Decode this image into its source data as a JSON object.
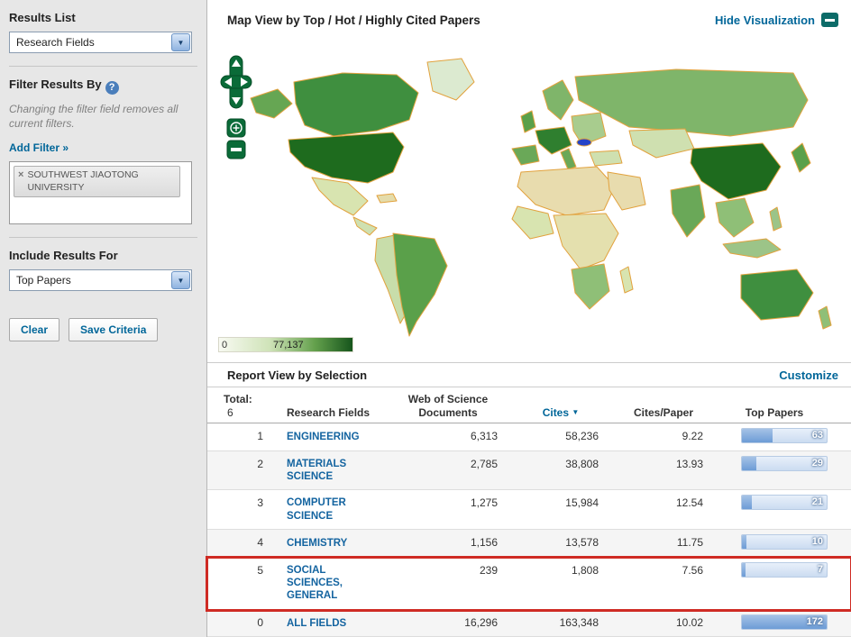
{
  "icons": {
    "chevron_down": "▼",
    "sort_desc": "▼",
    "help": "?",
    "remove": "×"
  },
  "sidebar": {
    "results_list": {
      "label": "Results List",
      "value": "Research Fields"
    },
    "filter": {
      "label": "Filter Results By",
      "note": "Changing the filter field removes all current filters.",
      "add_filter": "Add Filter »",
      "tag": "SOUTHWEST JIAOTONG UNIVERSITY"
    },
    "include": {
      "label": "Include Results For",
      "value": "Top Papers"
    },
    "buttons": {
      "clear": "Clear",
      "save": "Save Criteria"
    }
  },
  "map": {
    "title": "Map View by Top / Hot / Highly Cited Papers",
    "hide_link": "Hide Visualization",
    "legend": {
      "min": "0",
      "max": "77,137"
    }
  },
  "report": {
    "title": "Report View by Selection",
    "customize": "Customize",
    "total_label": "Total:",
    "total_value": "6",
    "columns": {
      "research_fields": "Research Fields",
      "documents": "Web of Science Documents",
      "cites": "Cites",
      "cites_per_paper": "Cites/Paper",
      "top_papers": "Top Papers"
    },
    "top_papers_max": 172,
    "rows": [
      {
        "rank": "1",
        "field": "ENGINEERING",
        "documents": "6,313",
        "cites": "58,236",
        "cites_per_paper": "9.22",
        "top_papers": "63",
        "top_papers_value": 63
      },
      {
        "rank": "2",
        "field": "MATERIALS SCIENCE",
        "documents": "2,785",
        "cites": "38,808",
        "cites_per_paper": "13.93",
        "top_papers": "29",
        "top_papers_value": 29
      },
      {
        "rank": "3",
        "field": "COMPUTER SCIENCE",
        "documents": "1,275",
        "cites": "15,984",
        "cites_per_paper": "12.54",
        "top_papers": "21",
        "top_papers_value": 21
      },
      {
        "rank": "4",
        "field": "CHEMISTRY",
        "documents": "1,156",
        "cites": "13,578",
        "cites_per_paper": "11.75",
        "top_papers": "10",
        "top_papers_value": 10
      },
      {
        "rank": "5",
        "field": "SOCIAL SCIENCES, GENERAL",
        "documents": "239",
        "cites": "1,808",
        "cites_per_paper": "7.56",
        "top_papers": "7",
        "top_papers_value": 7
      },
      {
        "rank": "0",
        "field": "ALL FIELDS",
        "documents": "16,296",
        "cites": "163,348",
        "cites_per_paper": "10.02",
        "top_papers": "172",
        "top_papers_value": 172
      }
    ]
  }
}
